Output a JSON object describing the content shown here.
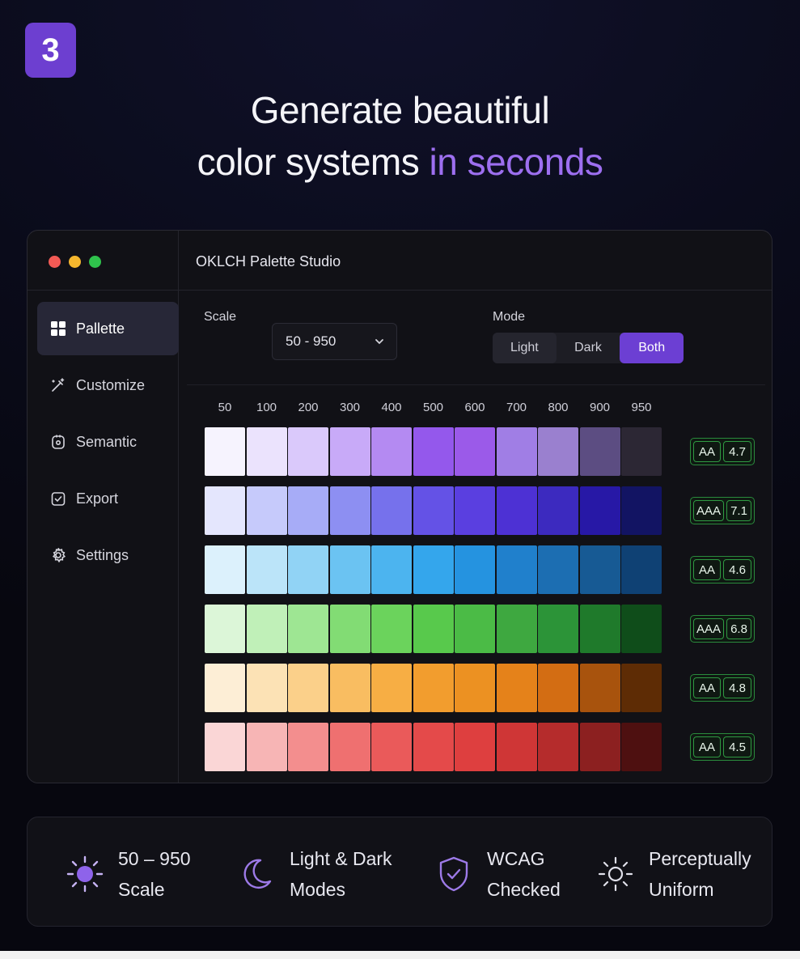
{
  "badge": {
    "number": "3"
  },
  "headline": {
    "line1": "Generate beautiful",
    "line2_plain": "color systems ",
    "line2_accent": "in seconds"
  },
  "window": {
    "title": "OKLCH Palette Studio"
  },
  "sidebar": {
    "items": [
      {
        "label": "Pallette",
        "icon": "palette-grid-icon",
        "active": true
      },
      {
        "label": "Customize",
        "icon": "magic-wand-icon",
        "active": false
      },
      {
        "label": "Semantic",
        "icon": "semantic-token-icon",
        "active": false
      },
      {
        "label": "Export",
        "icon": "export-check-icon",
        "active": false
      },
      {
        "label": "Settings",
        "icon": "gear-icon",
        "active": false
      }
    ]
  },
  "controls": {
    "scale_label": "Scale",
    "scale_value": "50 - 950",
    "mode_label": "Mode",
    "modes": [
      "Light",
      "Dark",
      "Both"
    ],
    "selected_mode": "Both"
  },
  "scale_steps": [
    "50",
    "100",
    "200",
    "300",
    "400",
    "500",
    "600",
    "700",
    "800",
    "900",
    "950"
  ],
  "palettes": [
    {
      "name": "purple",
      "level": "AA",
      "ratio": "4.7",
      "colors": [
        "#f6f3fe",
        "#ebe3fd",
        "#dac9fb",
        "#c8aaf8",
        "#b48af2",
        "#9458ec",
        "#9b5ae9",
        "#a07ee5",
        "#9a80cf",
        "#5c4d82",
        "#2c2734"
      ]
    },
    {
      "name": "indigo",
      "level": "AAA",
      "ratio": "7.1",
      "colors": [
        "#e4e6fd",
        "#c6cafb",
        "#a7acf7",
        "#8d8ff2",
        "#7671ec",
        "#6452e6",
        "#5a3fe0",
        "#4d31d4",
        "#3c2abf",
        "#2718a6",
        "#121463"
      ]
    },
    {
      "name": "blue",
      "level": "AA",
      "ratio": "4.6",
      "colors": [
        "#dcf1fc",
        "#bbe4f9",
        "#91d3f5",
        "#6bc3f2",
        "#4cb4ef",
        "#34a6ec",
        "#2593e0",
        "#2080cc",
        "#1c6eb2",
        "#175a94",
        "#0f4174"
      ]
    },
    {
      "name": "green",
      "level": "AAA",
      "ratio": "6.8",
      "colors": [
        "#dcf6d8",
        "#c0f0b8",
        "#9ee693",
        "#82dc74",
        "#6bd35c",
        "#58c94c",
        "#4bbb46",
        "#3ea840",
        "#2c9438",
        "#1f7a2b",
        "#0f4d1a"
      ]
    },
    {
      "name": "orange",
      "level": "AA",
      "ratio": "4.8",
      "colors": [
        "#fdeed6",
        "#fce2b5",
        "#fbd08a",
        "#f9bd61",
        "#f7ae44",
        "#f29d2e",
        "#ec9122",
        "#e5821a",
        "#d36d13",
        "#a8530d",
        "#5e2c05"
      ]
    },
    {
      "name": "red",
      "level": "AA",
      "ratio": "4.5",
      "colors": [
        "#fad6d6",
        "#f7b5b5",
        "#f38e8e",
        "#ef7070",
        "#ea5a5a",
        "#e44a4a",
        "#de3f3f",
        "#cf3636",
        "#b52c2c",
        "#8c2020",
        "#4e1010"
      ]
    }
  ],
  "features": [
    {
      "text": "50 – 950\nScale",
      "icon": "sun-filled-icon"
    },
    {
      "text": "Light & Dark\nModes",
      "icon": "moon-icon"
    },
    {
      "text": "WCAG\nChecked",
      "icon": "shield-check-icon"
    },
    {
      "text": "Perceptually\nUniform",
      "icon": "sun-outline-icon"
    }
  ],
  "colors": {
    "accent": "#6c3fd3",
    "accent_text": "#9d6ff0",
    "badge_border": "#2f9a42"
  }
}
